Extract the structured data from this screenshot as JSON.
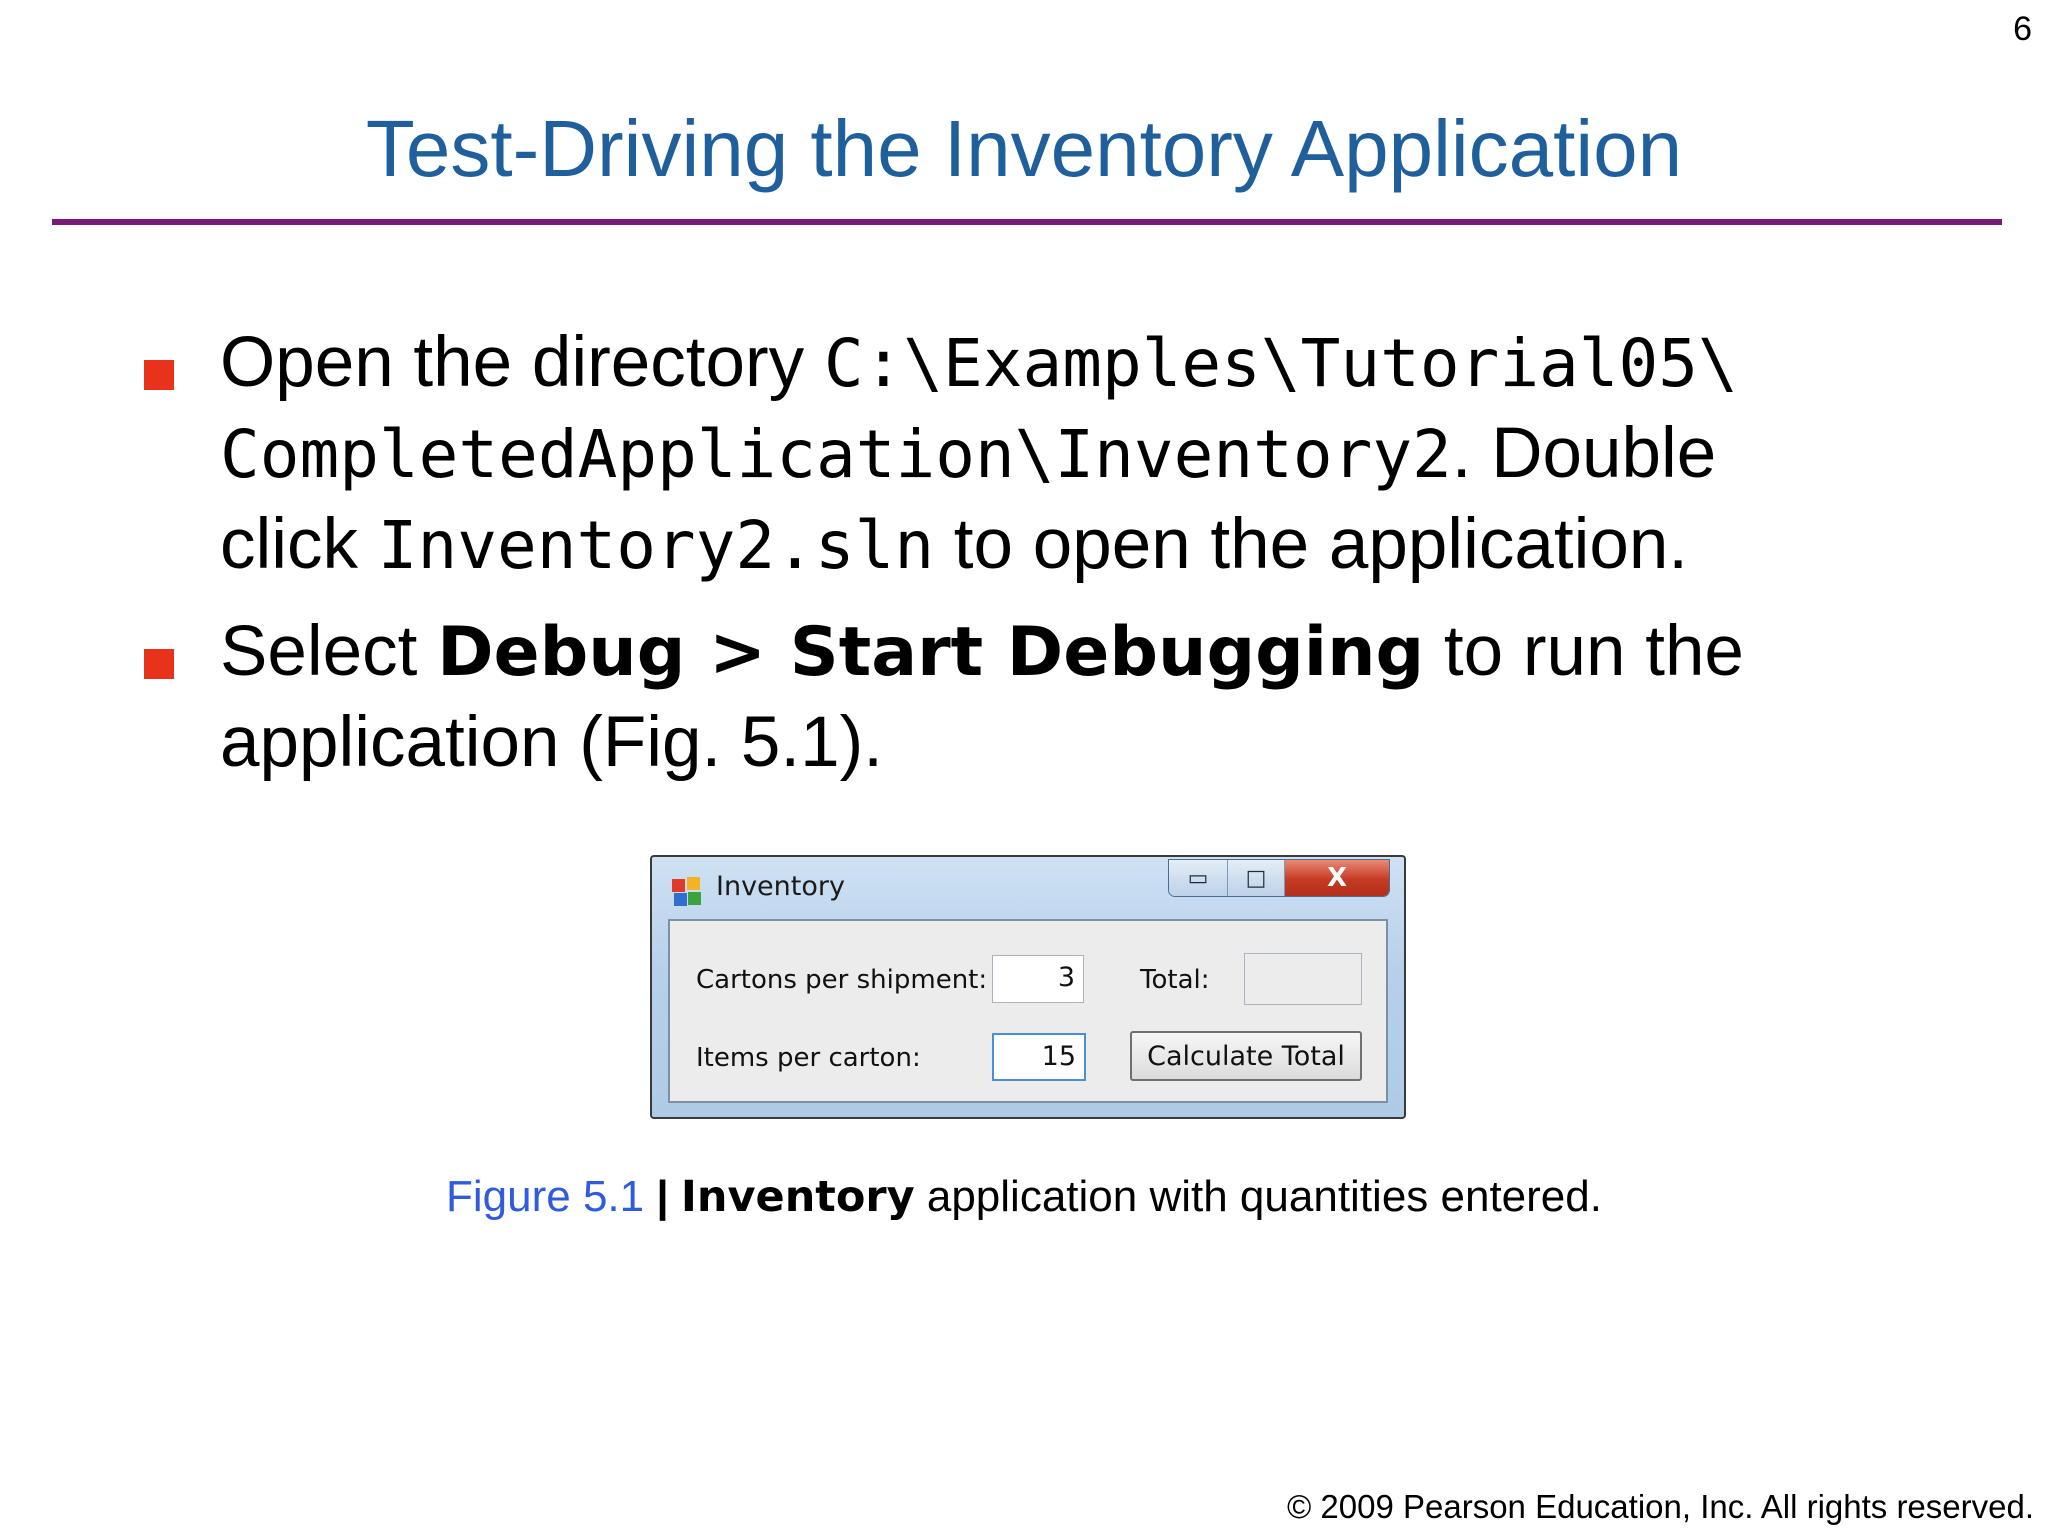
{
  "page_number": "6",
  "title": "Test-Driving the Inventory Application",
  "bullets": [
    {
      "parts": {
        "t1": "Open the directory ",
        "code1": "C:\\Examples\\Tutorial05\\",
        "code2": "CompletedApplication\\Inventory2",
        "t2": ". Double",
        "t3": "click ",
        "code3": "Inventory2.sln",
        "t4": " to open the application."
      }
    },
    {
      "parts": {
        "t1": "Select ",
        "bold1": "Debug > Start Debugging",
        "t2": " to run the",
        "t3": "application (Fig. 5.1)."
      }
    }
  ],
  "figure": {
    "window_title": "Inventory",
    "buttons": {
      "minimize": "▭",
      "maximize": "□",
      "close": "X"
    },
    "cartons_label": "Cartons per shipment:",
    "cartons_value": "3",
    "items_label": "Items per carton:",
    "items_value": "15",
    "total_label": "Total:",
    "total_value": "",
    "calculate_button": "Calculate Total",
    "icon": "application-window-icon"
  },
  "caption": {
    "figure_label": "Figure 5.1",
    "separator": " | ",
    "bold_name": "Inventory",
    "rest": " application with quantities entered."
  },
  "footer": "© 2009 Pearson Education, Inc.  All rights reserved.",
  "colors": {
    "title": "#1f5f9c",
    "rule": "#7a1a78",
    "bullet_marker": "#e8321c",
    "figure_label": "#2f5bde"
  }
}
